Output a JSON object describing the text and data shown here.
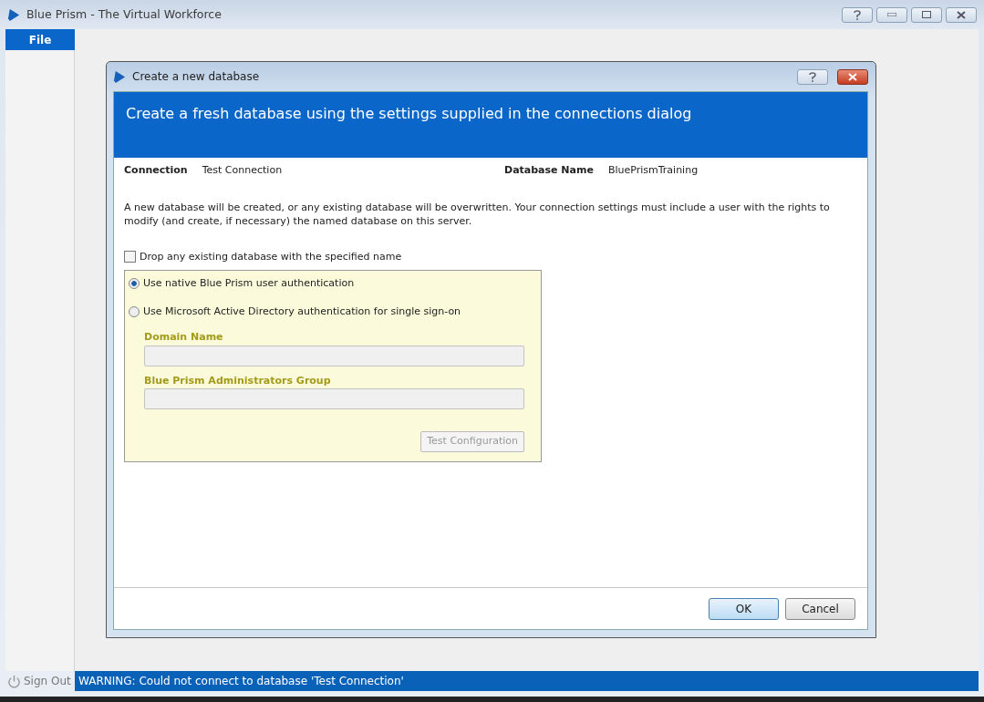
{
  "window": {
    "title": "Blue Prism - The Virtual Workforce"
  },
  "menu": [
    {
      "label": "File",
      "selected": true
    }
  ],
  "dialog": {
    "title": "Create a new database",
    "header": "Create a fresh database using the settings supplied in the connections dialog",
    "connection_label": "Connection",
    "connection_value": "Test Connection",
    "database_label": "Database Name",
    "database_value": "BluePrismTraining",
    "description": "A new database will be created, or any existing database will be overwritten. Your connection settings must include a user with the rights to modify (and create, if necessary) the named database on this server.",
    "drop_checkbox": {
      "label": "Drop any existing database with the specified name",
      "checked": false
    },
    "auth_options": [
      {
        "label": "Use native Blue Prism user authentication",
        "selected": true
      },
      {
        "label": "Use Microsoft Active Directory authentication for single sign-on",
        "selected": false
      }
    ],
    "fields": [
      {
        "label": "Domain Name",
        "disabled": true
      },
      {
        "label": "Blue Prism Administrators Group",
        "disabled": true
      }
    ],
    "test_button": {
      "label": "Test Configuration",
      "disabled": true
    },
    "buttons": [
      {
        "label": "OK",
        "focused": true
      },
      {
        "label": "Cancel",
        "focused": false
      }
    ]
  },
  "sign_out": "Sign Out",
  "status_bar": "WARNING: Could not connect to database 'Test Connection'"
}
